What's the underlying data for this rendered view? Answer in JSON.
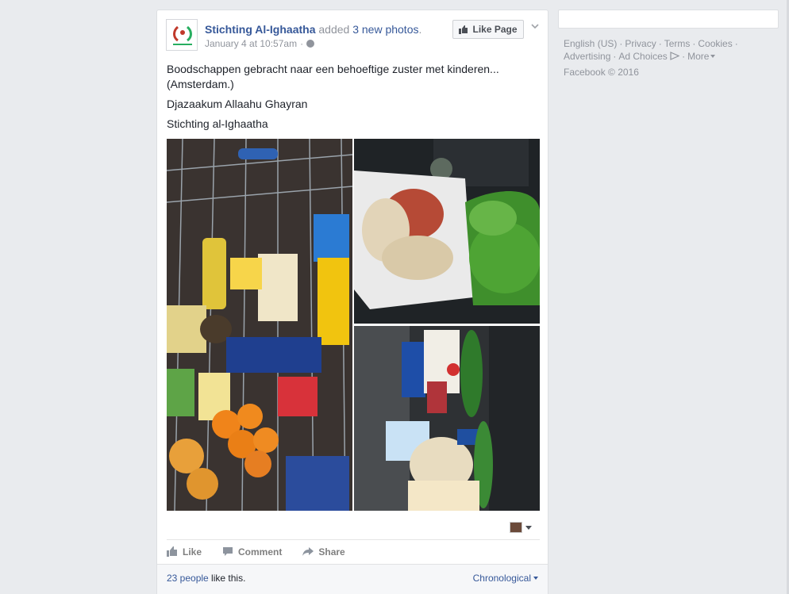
{
  "post": {
    "page_name": "Stichting Al-Ighaatha",
    "added_text": "added",
    "photos_link": "3 new photos",
    "period": ".",
    "timestamp": "January 4 at 10:57am",
    "dot": "·",
    "like_page_label": "Like Page",
    "paragraphs": [
      "Boodschappen gebracht naar een behoeftige zuster met kinderen...(Amsterdam.)",
      "Djazaakum Allaahu Ghayran",
      "Stichting al-Ighaatha"
    ],
    "actions": {
      "like": "Like",
      "comment": "Comment",
      "share": "Share"
    },
    "likes": {
      "people": "23 people",
      "suffix": " like this."
    },
    "sort_label": "Chronological"
  },
  "footer": {
    "links": [
      "English (US)",
      "Privacy",
      "Terms",
      "Cookies",
      "Advertising",
      "Ad Choices",
      "More"
    ],
    "separator": "·",
    "copyright": "Facebook © 2016"
  },
  "colors": {
    "link": "#365899",
    "muted": "#90949c",
    "background": "#e9ebee"
  },
  "icons": [
    "thumbs-up-icon",
    "globe-icon",
    "chevron-down-icon",
    "comment-icon",
    "share-icon",
    "adchoices-icon"
  ]
}
